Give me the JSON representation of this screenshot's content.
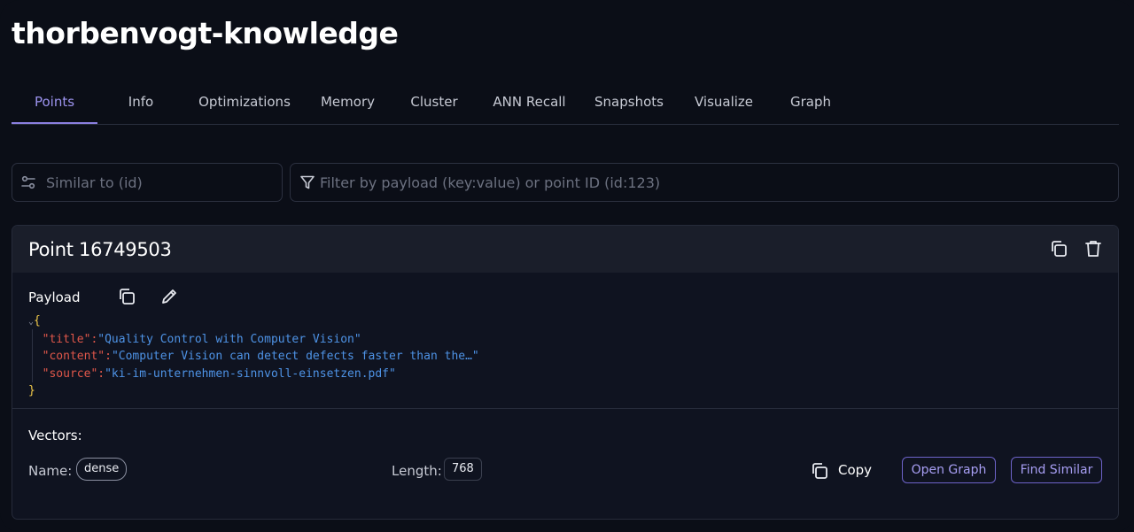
{
  "collection": {
    "title": "thorbenvogt-knowledge"
  },
  "tabs": [
    {
      "label": "Points",
      "active": true
    },
    {
      "label": "Info"
    },
    {
      "label": "Optimizations"
    },
    {
      "label": "Memory"
    },
    {
      "label": "Cluster"
    },
    {
      "label": "ANN Recall"
    },
    {
      "label": "Snapshots"
    },
    {
      "label": "Visualize"
    },
    {
      "label": "Graph"
    }
  ],
  "search": {
    "similar_placeholder": "Similar to (id)",
    "filter_placeholder": "Filter by payload (key:value) or point ID (id:123)"
  },
  "point": {
    "title": "Point 16749503",
    "payload_label": "Payload",
    "payload": {
      "open_brace": "{",
      "close_brace": "}",
      "fields": [
        {
          "key": "\"title\"",
          "value": "\"Quality Control with Computer Vision\""
        },
        {
          "key": "\"content\"",
          "value": "\"Computer Vision can detect defects faster than the…\""
        },
        {
          "key": "\"source\"",
          "value": "\"ki-im-unternehmen-sinnvoll-einsetzen.pdf\""
        }
      ]
    },
    "vectors": {
      "label": "Vectors:",
      "name_label": "Name:",
      "name_value": "dense",
      "length_label": "Length:",
      "length_value": "768",
      "copy_label": "Copy",
      "open_graph_label": "Open Graph",
      "find_similar_label": "Find Similar"
    }
  },
  "colors": {
    "accent": "#9c93ee",
    "json_key": "#e0574a",
    "json_value": "#4e93e6",
    "json_brace": "#f0c94a"
  },
  "icons": [
    "similar-icon",
    "filter-icon",
    "copy-icon",
    "trash-icon",
    "edit-icon",
    "chevron-down-icon"
  ]
}
